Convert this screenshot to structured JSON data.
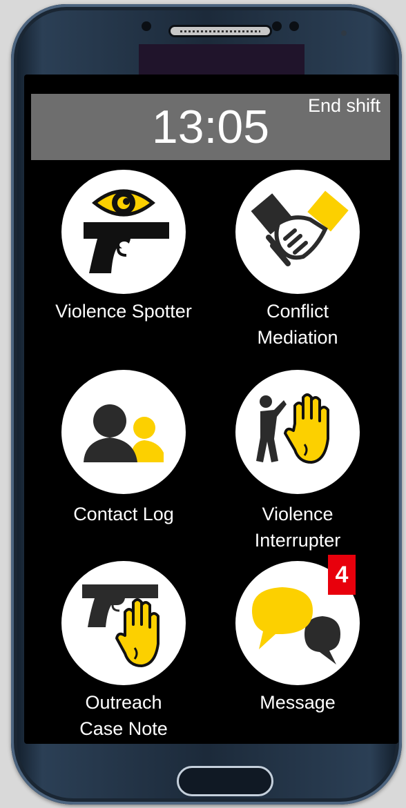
{
  "device": {
    "name": "smartphone"
  },
  "status": {
    "time": "13:05",
    "end_shift_label": "End shift"
  },
  "tiles": [
    {
      "label": "Violence Spotter",
      "icon": "eye-pistol-icon"
    },
    {
      "label": "Conflict Mediation",
      "icon": "handshake-icon"
    },
    {
      "label": "Contact Log",
      "icon": "people-icon"
    },
    {
      "label": "Violence Interrupter",
      "icon": "figure-stop-hand-icon"
    },
    {
      "label": "Outreach Case Note",
      "icon": "pistol-stop-hand-icon"
    },
    {
      "label": "Message",
      "icon": "chat-bubbles-icon"
    }
  ],
  "message_badge": {
    "count": "4"
  },
  "colors": {
    "accent_yellow": "#fcd000",
    "badge_red": "#e8000c",
    "icon_dark": "#2b2b2b",
    "clock_bar": "#6e6e6e"
  }
}
